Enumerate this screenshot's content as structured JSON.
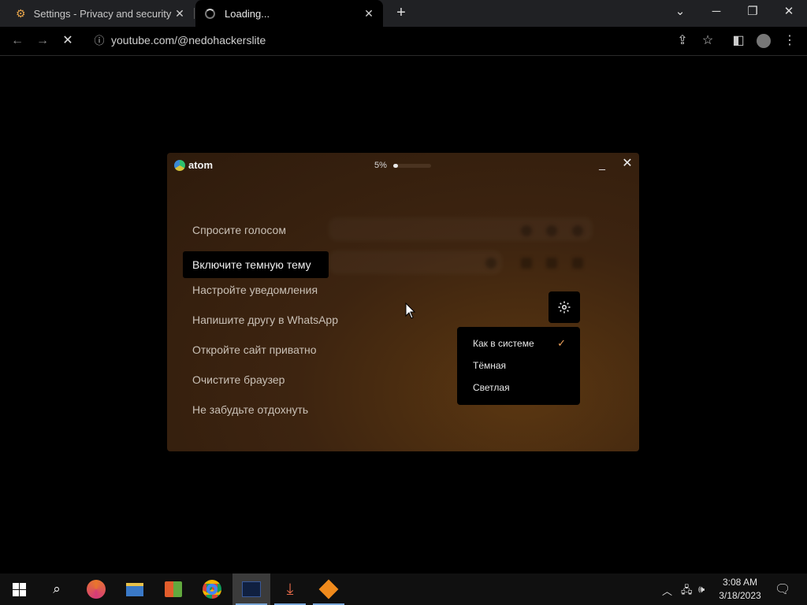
{
  "browser": {
    "tabs": [
      {
        "title": "Settings - Privacy and security",
        "icon": "gear-icon"
      },
      {
        "title": "Loading...",
        "icon": "loading-spinner-icon"
      }
    ],
    "url_host": "youtube.com",
    "url_path": "/@nedohackerslite"
  },
  "atom": {
    "logo_text": "atom",
    "progress_label": "5%",
    "progress_fraction": 0.05,
    "menu": [
      "Спросите голосом",
      "Включите темную тему",
      "Настройте уведомления",
      "Напишите другу в WhatsApp",
      "Откройте сайт приватно",
      "Очистите браузер",
      "Не забудьте отдохнуть"
    ],
    "theme_options": [
      {
        "label": "Как в системе",
        "selected": true
      },
      {
        "label": "Тёмная",
        "selected": false
      },
      {
        "label": "Светлая",
        "selected": false
      }
    ],
    "accent_color": "#f0a35c"
  },
  "taskbar": {
    "time": "3:08 AM",
    "date": "3/18/2023"
  }
}
